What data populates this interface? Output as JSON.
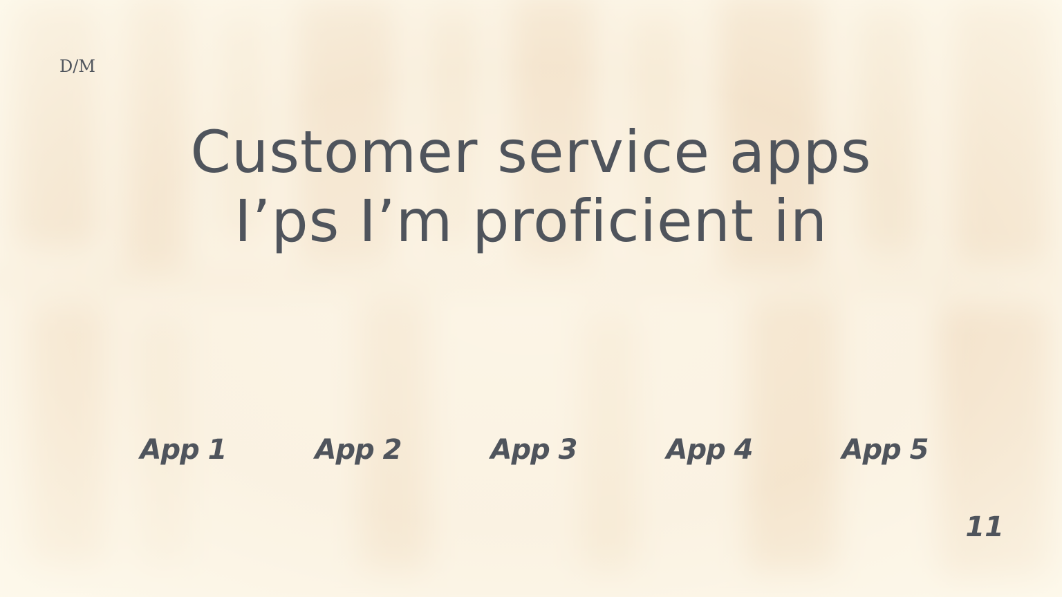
{
  "slide": {
    "logo": "D/M",
    "title_line1": "Customer service apps",
    "title_line2": "I’ps I’m proficient in",
    "apps": [
      "App 1",
      "App 2",
      "App 3",
      "App 4",
      "App 5"
    ],
    "page_number": "11"
  },
  "colors": {
    "background": "#f9f0e0",
    "text": "#4f545c"
  }
}
